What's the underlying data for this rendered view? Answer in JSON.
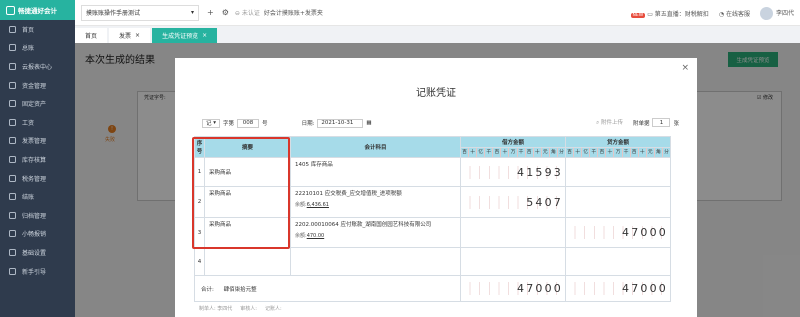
{
  "app": {
    "logo_text": "畅捷通好会计"
  },
  "sidebar": {
    "items": [
      {
        "label": "首页",
        "icon": "home-icon"
      },
      {
        "label": "总账",
        "icon": "ledger-icon"
      },
      {
        "label": "云报表中心",
        "icon": "report-icon"
      },
      {
        "label": "资金管理",
        "icon": "money-icon"
      },
      {
        "label": "固定资产",
        "icon": "asset-icon"
      },
      {
        "label": "工资",
        "icon": "salary-icon"
      },
      {
        "label": "发票管理",
        "icon": "invoice-icon"
      },
      {
        "label": "库存核算",
        "icon": "stock-icon"
      },
      {
        "label": "税务管理",
        "icon": "tax-icon"
      },
      {
        "label": "结账",
        "icon": "close-period-icon"
      },
      {
        "label": "归档管理",
        "icon": "archive-icon"
      },
      {
        "label": "小畅报销",
        "icon": "expense-icon"
      },
      {
        "label": "基础设置",
        "icon": "settings-icon"
      },
      {
        "label": "新手引导",
        "icon": "guide-icon"
      }
    ]
  },
  "topbar": {
    "account": "摸账账操作手册测试",
    "auth_text": "未认证",
    "notice": "好会计摸账账+发票夹",
    "new_badge": "NEW",
    "course": "第五直播：财税解扣",
    "service": "在线客服",
    "user": "李四代"
  },
  "tabs": [
    {
      "label": "首页",
      "active": false,
      "closable": false
    },
    {
      "label": "发票",
      "active": false,
      "closable": true
    },
    {
      "label": "生成凭证预览",
      "active": true,
      "closable": true
    }
  ],
  "background": {
    "page_title": "本次生成的结果",
    "generate_button": "生成凭证预览",
    "voucher_label": "凭证字号:",
    "modify_label": "修改",
    "fail_text": "失败"
  },
  "modal": {
    "title": "记账凭证",
    "voucher_word": "记",
    "word_label": "字第",
    "voucher_no": "008",
    "no_label": "号",
    "date_label": "日期:",
    "date": "2021-10-31",
    "attachment_extra": "附件上传",
    "attachment_label": "附单据",
    "attachment_count": "1",
    "attachment_unit": "张",
    "table": {
      "headers": {
        "seq": "序号",
        "summary": "摘要",
        "subject": "会计科目",
        "debit": "借方金额",
        "credit": "贷方金额"
      },
      "digit_units": [
        "百",
        "十",
        "亿",
        "千",
        "百",
        "十",
        "万",
        "千",
        "百",
        "十",
        "元",
        "角",
        "分"
      ],
      "rows": [
        {
          "seq": "1",
          "summary": "采购商品",
          "subject": "1405 库存商品",
          "balance_label": "",
          "balance": "",
          "debit": "41593",
          "credit": ""
        },
        {
          "seq": "2",
          "summary": "采购商品",
          "subject": "22210101 应交税费_应交增值税_进项税额",
          "balance_label": "余额:",
          "balance": "6,436.61",
          "debit": "5407",
          "credit": ""
        },
        {
          "seq": "3",
          "summary": "采购商品",
          "subject": "2202.00010064 应付账款_湖南国创园艺科技有限公司",
          "balance_label": "余额:",
          "balance": "470.00",
          "debit": "",
          "credit": "47000"
        },
        {
          "seq": "4",
          "summary": "",
          "subject": "",
          "balance_label": "",
          "balance": "",
          "debit": "",
          "credit": ""
        }
      ],
      "total_label": "合计:",
      "total_words": "肆佰柒拾元整",
      "total_debit": "47000",
      "total_credit": "47000"
    },
    "footer": {
      "maker_label": "制单人:",
      "maker": "李四代",
      "reviewer_label": "审核人:",
      "reviewer": "",
      "bookkeeper_label": "记账人:"
    }
  }
}
